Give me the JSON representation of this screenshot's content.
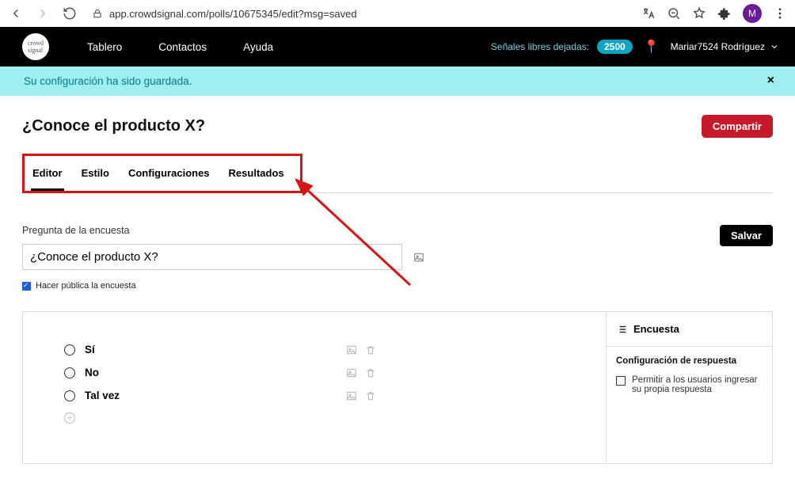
{
  "browser": {
    "url": "app.crowdsignal.com/polls/10675345/edit?msg=saved",
    "avatar_initial": "M"
  },
  "topnav": {
    "items": [
      "Tablero",
      "Contactos",
      "Ayuda"
    ],
    "signals_label": "Señales libres dejadas:",
    "signals_count": "2500",
    "user_name": "Mariar7524 Rodríguez"
  },
  "banner": {
    "msg": "Su configuración ha sido guardada."
  },
  "page": {
    "title": "¿Conoce el producto X?",
    "share": "Compartir",
    "save": "Salvar"
  },
  "tabs": [
    "Editor",
    "Estilo",
    "Configuraciones",
    "Resultados"
  ],
  "question": {
    "label": "Pregunta de la encuesta",
    "value": "¿Conoce el producto X?",
    "public_label": "Hacer pública la encuesta"
  },
  "answers": [
    "Sí",
    "No",
    "Tal vez"
  ],
  "sidebar": {
    "head": "Encuesta",
    "subhead": "Configuración de respuesta",
    "opt1": "Permitir a los usuarios ingresar su propia respuesta"
  }
}
